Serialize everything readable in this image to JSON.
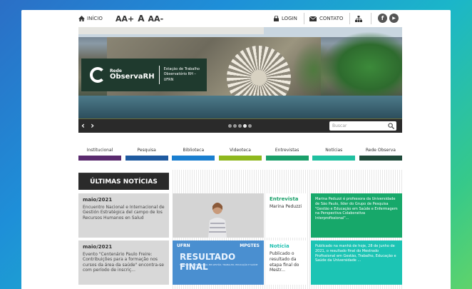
{
  "topbar": {
    "home_label": "INÍCIO",
    "font_increase": "AA+",
    "font_normal": "A",
    "font_decrease": "AA-",
    "login_label": "LOGIN",
    "contato_label": "CONTATO",
    "facebook": "f",
    "youtube": "▶"
  },
  "banner": {
    "logo_small": "Rede",
    "logo_big": "ObservaRH",
    "tagline_1": "Estação de Trabalho",
    "tagline_2": "Observatório RH – UFRN"
  },
  "slider": {
    "prev": "‹",
    "next": "›",
    "search_placeholder": "Buscar",
    "dots": 5,
    "active_dot": 4
  },
  "nav": [
    {
      "label": "Institucional",
      "color": "#5a2a6e"
    },
    {
      "label": "Pesquisa",
      "color": "#1e5aa0"
    },
    {
      "label": "Biblioteca",
      "color": "#1a7fd0"
    },
    {
      "label": "Videoteca",
      "color": "#8fb81e"
    },
    {
      "label": "Entrevistas",
      "color": "#1aa06a"
    },
    {
      "label": "Notícias",
      "color": "#20c0a0"
    },
    {
      "label": "Rede Observa",
      "color": "#1f4a3a"
    }
  ],
  "section_title": "ÚLTIMAS NOTÍCIAS",
  "news": [
    {
      "month": "maio/2021",
      "title": "Encuentro Nacional e Internacional de Gestión Estratégica del campo de los Recursos Humanos en Salud",
      "kind": "Entrevista",
      "kind_color": "#1aa06a",
      "summary": "Marina Peduzzi",
      "detail": "Marina Peduzzi é professora da Universidade de São Paulo, líder do Grupo de Pesquisa \"Gestão e Educação em Saúde e Enfermagem na Perspectiva Colaborativa Interprofissional\"...",
      "detail_color": "#17a86a"
    },
    {
      "month": "maio/2021",
      "title": "Evento \"Centenário Paulo Freire: Contribuições para a formação nos cursos da área da saúde\" encontra-se com período de inscriç...",
      "kind": "Notícia",
      "kind_color": "#20c0b0",
      "summary": "Publicado o resultado da etapa final do Mestr...",
      "detail": "Publicado na manhã de hoje, 28 de junho de 2021, o resultado final do Mestrado Profissional em Gestão, Trabalho, Educação e Saúde da Universidade ...",
      "detail_color": "#1cc4b4",
      "image_left": "UFRN",
      "image_right": "MPGTES",
      "image_title": "RESULTADO FINAL",
      "image_sub": "MESTRADO PROFISSIONAL EM GESTÃO, TRABALHO, EDUCAÇÃO E SAÚDE"
    }
  ]
}
